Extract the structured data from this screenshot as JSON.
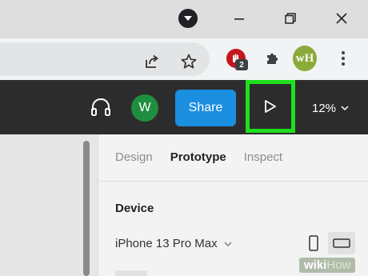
{
  "browser": {
    "window_controls": {
      "dropdown_icon": "chevron-down-icon",
      "minimize_icon": "minimize-icon",
      "restore_icon": "restore-icon",
      "close_icon": "close-icon"
    },
    "toolbar": {
      "share_icon": "share-icon",
      "bookmark_icon": "star-icon",
      "blocker_badge_count": "2",
      "extensions_icon": "puzzle-icon",
      "extension_profile_label": "wH",
      "menu_icon": "kebab-icon"
    }
  },
  "app": {
    "audio_icon": "headphones-icon",
    "avatar_initial": "W",
    "share_label": "Share",
    "present_icon": "play-icon",
    "zoom_label": "12%",
    "colors": {
      "topbar": "#2c2c2c",
      "share_button": "#1b8ee0",
      "avatar": "#1f8e3e",
      "highlight": "#1ee01e"
    }
  },
  "panel": {
    "tabs": [
      {
        "label": "Design",
        "active": false
      },
      {
        "label": "Prototype",
        "active": true
      },
      {
        "label": "Inspect",
        "active": false
      }
    ],
    "section_title": "Device",
    "device_value": "iPhone 13 Pro Max"
  },
  "watermark": {
    "prefix": "wiki",
    "suffix": "How"
  }
}
